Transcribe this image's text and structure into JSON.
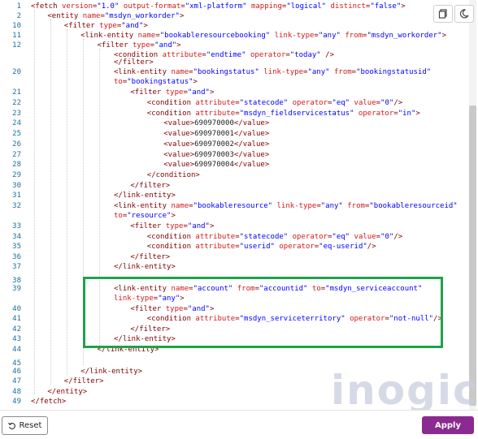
{
  "toolbar": {
    "copy_icon": "copy-icon",
    "theme_icon": "theme-toggle-icon"
  },
  "editor": {
    "lines": [
      {
        "n": "1",
        "tokens": [
          [
            "tag",
            "<fetch "
          ],
          [
            "attr",
            "version"
          ],
          [
            "punc",
            "="
          ],
          [
            "val",
            "\"1.0\""
          ],
          [
            "punc",
            " "
          ],
          [
            "attr",
            "output-format"
          ],
          [
            "punc",
            "="
          ],
          [
            "val",
            "\"xml-platform\""
          ],
          [
            "punc",
            " "
          ],
          [
            "attr",
            "mapping"
          ],
          [
            "punc",
            "="
          ],
          [
            "val",
            "\"logical\""
          ],
          [
            "punc",
            " "
          ],
          [
            "attr",
            "distinct"
          ],
          [
            "punc",
            "="
          ],
          [
            "val",
            "\"false\""
          ],
          [
            "tag",
            ">"
          ]
        ]
      },
      {
        "n": "2",
        "tokens": [
          [
            "tag",
            "<entity "
          ],
          [
            "attr",
            "name"
          ],
          [
            "punc",
            "="
          ],
          [
            "val",
            "\"msdyn_workorder\""
          ],
          [
            "tag",
            ">"
          ]
        ]
      },
      {
        "n": "10",
        "tokens": [
          [
            "tag",
            "<filter "
          ],
          [
            "attr",
            "type"
          ],
          [
            "punc",
            "="
          ],
          [
            "val",
            "\"and\""
          ],
          [
            "tag",
            ">"
          ]
        ]
      },
      {
        "n": "11",
        "tokens": [
          [
            "tag",
            "<link-entity "
          ],
          [
            "attr",
            "name"
          ],
          [
            "punc",
            "="
          ],
          [
            "val",
            "\"bookableresourcebooking\""
          ],
          [
            "punc",
            " "
          ],
          [
            "attr",
            "link-type"
          ],
          [
            "punc",
            "="
          ],
          [
            "val",
            "\"any\""
          ],
          [
            "punc",
            " "
          ],
          [
            "attr",
            "from"
          ],
          [
            "punc",
            "="
          ],
          [
            "val",
            "\"msdyn_workorder\""
          ],
          [
            "tag",
            ">"
          ]
        ]
      },
      {
        "n": "12",
        "tokens": [
          [
            "tag",
            "<filter "
          ],
          [
            "attr",
            "type"
          ],
          [
            "punc",
            "="
          ],
          [
            "val",
            "\"and\""
          ],
          [
            "tag",
            ">"
          ]
        ]
      },
      {
        "n": "",
        "tokens": [
          [
            "tag",
            "<condition "
          ],
          [
            "attr",
            "attribute"
          ],
          [
            "punc",
            "="
          ],
          [
            "val",
            "\"endtime\""
          ],
          [
            "punc",
            " "
          ],
          [
            "attr",
            "operator"
          ],
          [
            "punc",
            "="
          ],
          [
            "val",
            "\"today\""
          ],
          [
            "tag",
            " />"
          ]
        ]
      },
      {
        "n": "",
        "tokens": [
          [
            "tag",
            "</filter>"
          ]
        ]
      },
      {
        "n": "20",
        "tokens": [
          [
            "tag",
            "<link-entity "
          ],
          [
            "attr",
            "name"
          ],
          [
            "punc",
            "="
          ],
          [
            "val",
            "\"bookingstatus\""
          ],
          [
            "punc",
            " "
          ],
          [
            "attr",
            "link-type"
          ],
          [
            "punc",
            "="
          ],
          [
            "val",
            "\"any\""
          ],
          [
            "punc",
            " "
          ],
          [
            "attr",
            "from"
          ],
          [
            "punc",
            "="
          ],
          [
            "val",
            "\"bookingstatusid\""
          ]
        ]
      },
      {
        "n": "",
        "tokens": [
          [
            "attr",
            "to"
          ],
          [
            "punc",
            "="
          ],
          [
            "val",
            "\"bookingstatus\""
          ],
          [
            "tag",
            ">"
          ]
        ]
      },
      {
        "n": "21",
        "tokens": [
          [
            "tag",
            "<filter "
          ],
          [
            "attr",
            "type"
          ],
          [
            "punc",
            "="
          ],
          [
            "val",
            "\"and\""
          ],
          [
            "tag",
            ">"
          ]
        ]
      },
      {
        "n": "22",
        "tokens": [
          [
            "tag",
            "<condition "
          ],
          [
            "attr",
            "attribute"
          ],
          [
            "punc",
            "="
          ],
          [
            "val",
            "\"statecode\""
          ],
          [
            "punc",
            " "
          ],
          [
            "attr",
            "operator"
          ],
          [
            "punc",
            "="
          ],
          [
            "val",
            "\"eq\""
          ],
          [
            "punc",
            " "
          ],
          [
            "attr",
            "value"
          ],
          [
            "punc",
            "="
          ],
          [
            "val",
            "\"0\""
          ],
          [
            "tag",
            "/>"
          ]
        ]
      },
      {
        "n": "23",
        "tokens": [
          [
            "tag",
            "<condition "
          ],
          [
            "attr",
            "attribute"
          ],
          [
            "punc",
            "="
          ],
          [
            "val",
            "\"msdyn_fieldservicestatus\""
          ],
          [
            "punc",
            " "
          ],
          [
            "attr",
            "operator"
          ],
          [
            "punc",
            "="
          ],
          [
            "val",
            "\"in\""
          ],
          [
            "tag",
            ">"
          ]
        ]
      },
      {
        "n": "24",
        "tokens": [
          [
            "tag",
            "<value>"
          ],
          [
            "text",
            "690970000"
          ],
          [
            "tag",
            "</value>"
          ]
        ]
      },
      {
        "n": "25",
        "tokens": [
          [
            "tag",
            "<value>"
          ],
          [
            "text",
            "690970001"
          ],
          [
            "tag",
            "</value>"
          ]
        ]
      },
      {
        "n": "26",
        "tokens": [
          [
            "tag",
            "<value>"
          ],
          [
            "text",
            "690970002"
          ],
          [
            "tag",
            "</value>"
          ]
        ]
      },
      {
        "n": "27",
        "tokens": [
          [
            "tag",
            "<value>"
          ],
          [
            "text",
            "690970003"
          ],
          [
            "tag",
            "</value>"
          ]
        ]
      },
      {
        "n": "28",
        "tokens": [
          [
            "tag",
            "<value>"
          ],
          [
            "text",
            "690970004"
          ],
          [
            "tag",
            "</value>"
          ]
        ]
      },
      {
        "n": "29",
        "tokens": [
          [
            "tag",
            "</condition>"
          ]
        ]
      },
      {
        "n": "30",
        "tokens": [
          [
            "tag",
            "</filter>"
          ]
        ]
      },
      {
        "n": "31",
        "tokens": [
          [
            "tag",
            "</link-entity>"
          ]
        ]
      },
      {
        "n": "32",
        "tokens": [
          [
            "tag",
            "<link-entity "
          ],
          [
            "attr",
            "name"
          ],
          [
            "punc",
            "="
          ],
          [
            "val",
            "\"bookableresource\""
          ],
          [
            "punc",
            " "
          ],
          [
            "attr",
            "link-type"
          ],
          [
            "punc",
            "="
          ],
          [
            "val",
            "\"any\""
          ],
          [
            "punc",
            " "
          ],
          [
            "attr",
            "from"
          ],
          [
            "punc",
            "="
          ],
          [
            "val",
            "\"bookableresourceid\""
          ]
        ]
      },
      {
        "n": "",
        "tokens": [
          [
            "attr",
            "to"
          ],
          [
            "punc",
            "="
          ],
          [
            "val",
            "\"resource\""
          ],
          [
            "tag",
            ">"
          ]
        ]
      },
      {
        "n": "33",
        "tokens": [
          [
            "tag",
            "<filter "
          ],
          [
            "attr",
            "type"
          ],
          [
            "punc",
            "="
          ],
          [
            "val",
            "\"and\""
          ],
          [
            "tag",
            ">"
          ]
        ]
      },
      {
        "n": "34",
        "tokens": [
          [
            "tag",
            "<condition "
          ],
          [
            "attr",
            "attribute"
          ],
          [
            "punc",
            "="
          ],
          [
            "val",
            "\"statecode\""
          ],
          [
            "punc",
            " "
          ],
          [
            "attr",
            "operator"
          ],
          [
            "punc",
            "="
          ],
          [
            "val",
            "\"eq\""
          ],
          [
            "punc",
            " "
          ],
          [
            "attr",
            "value"
          ],
          [
            "punc",
            "="
          ],
          [
            "val",
            "\"0\""
          ],
          [
            "tag",
            "/>"
          ]
        ]
      },
      {
        "n": "35",
        "tokens": [
          [
            "tag",
            "<condition "
          ],
          [
            "attr",
            "attribute"
          ],
          [
            "punc",
            "="
          ],
          [
            "val",
            "\"userid\""
          ],
          [
            "punc",
            " "
          ],
          [
            "attr",
            "operator"
          ],
          [
            "punc",
            "="
          ],
          [
            "val",
            "\"eq-userid\""
          ],
          [
            "tag",
            "/>"
          ]
        ]
      },
      {
        "n": "36",
        "tokens": [
          [
            "tag",
            "</filter>"
          ]
        ]
      },
      {
        "n": "37",
        "tokens": [
          [
            "tag",
            "</link-entity>"
          ]
        ]
      },
      {
        "n": "38",
        "tokens": []
      },
      {
        "n": "39",
        "tokens": [
          [
            "tag",
            "<link-entity "
          ],
          [
            "attr",
            "name"
          ],
          [
            "punc",
            "="
          ],
          [
            "val",
            "\"account\""
          ],
          [
            "punc",
            " "
          ],
          [
            "attr",
            "from"
          ],
          [
            "punc",
            "="
          ],
          [
            "val",
            "\"accountid\""
          ],
          [
            "punc",
            " "
          ],
          [
            "attr",
            "to"
          ],
          [
            "punc",
            "="
          ],
          [
            "val",
            "\"msdyn_serviceaccount\""
          ]
        ]
      },
      {
        "n": "",
        "tokens": [
          [
            "attr",
            "link-type"
          ],
          [
            "punc",
            "="
          ],
          [
            "val",
            "\"any\""
          ],
          [
            "tag",
            ">"
          ]
        ]
      },
      {
        "n": "40",
        "tokens": [
          [
            "tag",
            "<filter "
          ],
          [
            "attr",
            "type"
          ],
          [
            "punc",
            "="
          ],
          [
            "val",
            "\"and\""
          ],
          [
            "tag",
            ">"
          ]
        ]
      },
      {
        "n": "41",
        "tokens": [
          [
            "tag",
            "<condition "
          ],
          [
            "attr",
            "attribute"
          ],
          [
            "punc",
            "="
          ],
          [
            "val",
            "\"msdyn_serviceterritory\""
          ],
          [
            "punc",
            " "
          ],
          [
            "attr",
            "operator"
          ],
          [
            "punc",
            "="
          ],
          [
            "val",
            "\"not-null\""
          ],
          [
            "tag",
            "/>"
          ]
        ]
      },
      {
        "n": "42",
        "tokens": [
          [
            "tag",
            "</filter>"
          ]
        ]
      },
      {
        "n": "43",
        "tokens": [
          [
            "tag",
            "</link-entity>"
          ]
        ]
      },
      {
        "n": "44",
        "tokens": [
          [
            "tag",
            "</link-entity>"
          ]
        ]
      },
      {
        "n": "45",
        "tokens": []
      },
      {
        "n": "46",
        "tokens": [
          [
            "tag",
            "</link-entity>"
          ]
        ]
      },
      {
        "n": "47",
        "tokens": [
          [
            "tag",
            "</filter>"
          ]
        ]
      },
      {
        "n": "48",
        "tokens": [
          [
            "tag",
            "</entity>"
          ]
        ]
      },
      {
        "n": "49",
        "tokens": [
          [
            "tag",
            "</fetch>"
          ]
        ]
      }
    ]
  },
  "watermark": "inogic",
  "footer": {
    "reset_label": "Reset",
    "apply_label": "Apply"
  },
  "colors": {
    "apply_bg": "#8b2a90",
    "highlight_border": "#1fa24a",
    "tag": "#800000",
    "attr": "#d11a1a",
    "val": "#0000ff"
  }
}
